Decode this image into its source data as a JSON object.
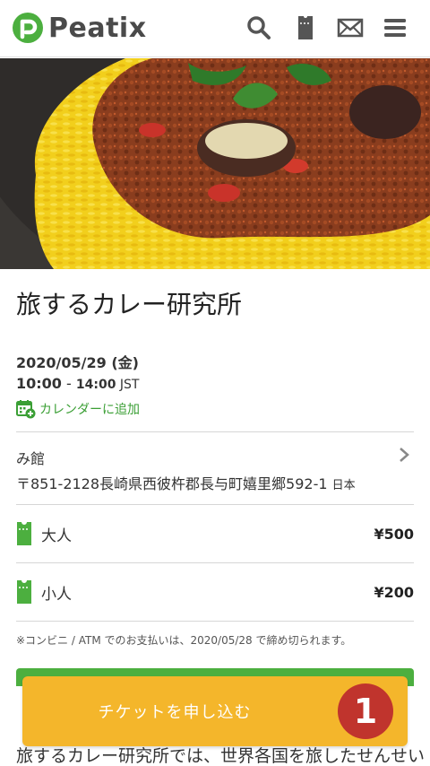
{
  "header": {
    "logo_text": "Peatix",
    "icons": [
      "search-icon",
      "ticket-icon",
      "mail-icon",
      "menu-icon"
    ]
  },
  "event": {
    "title": "旅するカレー研究所",
    "date": "2020/05/29 (金)",
    "time_start": "10:00",
    "time_sep": " - ",
    "time_end": "14:00",
    "timezone": " JST",
    "add_calendar": "カレンダーに追加"
  },
  "venue": {
    "name": "み館",
    "address": "〒851-2128長崎県西彼杵郡長与町嬉里郷592-1",
    "country": "日本"
  },
  "tickets": [
    {
      "name": "大人",
      "price": "¥500"
    },
    {
      "name": "小人",
      "price": "¥200"
    }
  ],
  "note": "※コンビニ / ATM でのお支払いは、2020/05/28 で締め切られます。",
  "cta": {
    "label": "チケットを申し込む",
    "step_badge": "1"
  },
  "description": "旅するカレー研究所では、世界各国を旅したせんせい",
  "colors": {
    "brand_green": "#4caf3f",
    "cta_yellow": "#f4b62b",
    "badge_red": "#c0342d",
    "calendar_green": "#3b9f35"
  }
}
